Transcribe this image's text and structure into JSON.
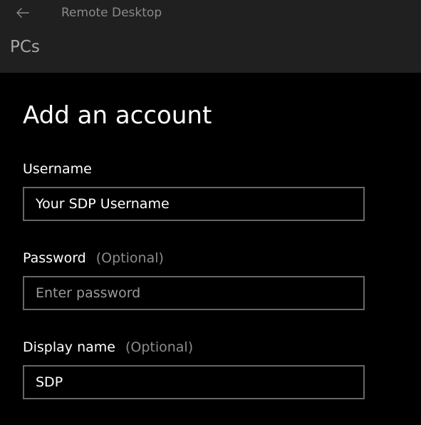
{
  "window": {
    "app_title": "Remote Desktop",
    "page_header": "PCs"
  },
  "dialog": {
    "title": "Add an account",
    "username": {
      "label": "Username",
      "value": "Your SDP Username"
    },
    "password": {
      "label": "Password",
      "optional": "(Optional)",
      "placeholder": "Enter password",
      "value": ""
    },
    "display_name": {
      "label": "Display name",
      "optional": "(Optional)",
      "value": "SDP"
    }
  },
  "colors": {
    "titlebar": "#202020",
    "background": "#000000",
    "field_border": "#666666",
    "text": "#ffffff",
    "muted": "#8c8c8c"
  },
  "icons": {
    "back": "back-arrow-icon"
  }
}
